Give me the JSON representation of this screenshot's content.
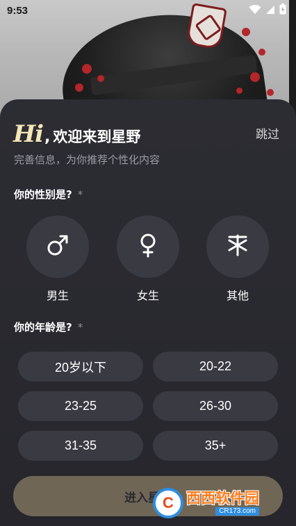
{
  "status_bar": {
    "time": "9:53",
    "icons": [
      "wifi-icon",
      "signal-icon",
      "battery-icon"
    ]
  },
  "header": {
    "hi": "Hi",
    "comma": ",",
    "title": "欢迎来到星野",
    "skip_label": "跳过",
    "subtitle": "完善信息，为你推荐个性化内容"
  },
  "gender": {
    "question": "你的性别是?",
    "required_mark": "*",
    "options": [
      {
        "label": "男生",
        "icon": "male-icon"
      },
      {
        "label": "女生",
        "icon": "female-icon"
      },
      {
        "label": "其他",
        "icon": "other-gender-icon"
      }
    ]
  },
  "age": {
    "question": "你的年龄是?",
    "required_mark": "*",
    "options": [
      "20岁以下",
      "20-22",
      "23-25",
      "26-30",
      "31-35",
      "35+"
    ]
  },
  "submit_label": "进入星野",
  "watermark": {
    "logo_text": "C",
    "main_text": "西西软件园",
    "sub_text": "CR173.com"
  },
  "colors": {
    "sheet_bg": "#2c2c33",
    "option_bg": "#3a3a43",
    "accent_hi": "#f5e6b8",
    "enter_button": "#6f6656"
  }
}
